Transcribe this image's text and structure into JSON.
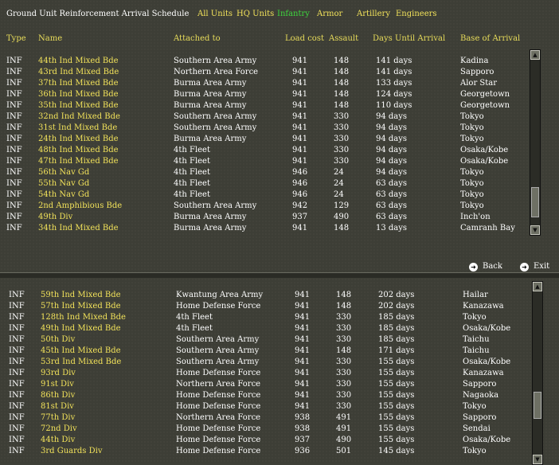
{
  "header": {
    "title": "Ground Unit Reinforcement Arrival Schedule",
    "tabs": [
      {
        "label": "All Units",
        "active": false
      },
      {
        "label": "HQ Units",
        "active": false
      },
      {
        "label": "Infantry",
        "active": true
      },
      {
        "label": "Armor",
        "active": false
      },
      {
        "label": "Artillery",
        "active": false
      },
      {
        "label": "Engineers",
        "active": false
      }
    ]
  },
  "columns": [
    "Type",
    "Name",
    "Attached to",
    "Load cost",
    "Assault",
    "Days Until Arrival",
    "Base of Arrival"
  ],
  "top_rows": [
    [
      "INF",
      "44th Ind Mixed Bde",
      "Southern Area Army",
      "941",
      "148",
      "141 days",
      "Kadina"
    ],
    [
      "INF",
      "43rd Ind Mixed Bde",
      "Northern Area Force",
      "941",
      "148",
      "141 days",
      "Sapporo"
    ],
    [
      "INF",
      "37th Ind Mixed Bde",
      "Burma Area Army",
      "941",
      "148",
      "133 days",
      "Alor Star"
    ],
    [
      "INF",
      "36th Ind Mixed Bde",
      "Burma Area Army",
      "941",
      "148",
      "124 days",
      "Georgetown"
    ],
    [
      "INF",
      "35th Ind Mixed Bde",
      "Burma Area Army",
      "941",
      "148",
      "110 days",
      "Georgetown"
    ],
    [
      "INF",
      "32nd Ind Mixed Bde",
      "Southern Area Army",
      "941",
      "330",
      "94 days",
      "Tokyo"
    ],
    [
      "INF",
      "31st Ind Mixed Bde",
      "Southern Area Army",
      "941",
      "330",
      "94 days",
      "Tokyo"
    ],
    [
      "INF",
      "24th Ind Mixed Bde",
      "Burma Area Army",
      "941",
      "330",
      "94 days",
      "Tokyo"
    ],
    [
      "INF",
      "48th Ind Mixed Bde",
      "4th Fleet",
      "941",
      "330",
      "94 days",
      "Osaka/Kobe"
    ],
    [
      "INF",
      "47th Ind Mixed Bde",
      "4th Fleet",
      "941",
      "330",
      "94 days",
      "Osaka/Kobe"
    ],
    [
      "INF",
      "56th Nav Gd",
      "4th Fleet",
      "946",
      "24",
      "94 days",
      "Tokyo"
    ],
    [
      "INF",
      "55th Nav Gd",
      "4th Fleet",
      "946",
      "24",
      "63 days",
      "Tokyo"
    ],
    [
      "INF",
      "54th Nav Gd",
      "4th Fleet",
      "946",
      "24",
      "63 days",
      "Tokyo"
    ],
    [
      "INF",
      "2nd Amphibious Bde",
      "Southern Area Army",
      "942",
      "129",
      "63 days",
      "Tokyo"
    ],
    [
      "INF",
      "49th Div",
      "Burma Area Army",
      "937",
      "490",
      "63 days",
      "Inch'on"
    ],
    [
      "INF",
      "34th Ind Mixed Bde",
      "Burma Area Army",
      "941",
      "148",
      "13 days",
      "Camranh Bay"
    ]
  ],
  "bottom_rows": [
    [
      "INF",
      "59th Ind Mixed Bde",
      "Kwantung Area Army",
      "941",
      "148",
      "202 days",
      "Hailar"
    ],
    [
      "INF",
      "57th Ind Mixed Bde",
      "Home Defense Force",
      "941",
      "148",
      "202 days",
      "Kanazawa"
    ],
    [
      "INF",
      "128th Ind Mixed Bde",
      "4th Fleet",
      "941",
      "330",
      "185 days",
      "Tokyo"
    ],
    [
      "INF",
      "49th Ind Mixed Bde",
      "4th Fleet",
      "941",
      "330",
      "185 days",
      "Osaka/Kobe"
    ],
    [
      "INF",
      "50th Div",
      "Southern Area Army",
      "941",
      "330",
      "185 days",
      "Taichu"
    ],
    [
      "INF",
      "45th Ind Mixed Bde",
      "Southern Area Army",
      "941",
      "148",
      "171 days",
      "Taichu"
    ],
    [
      "INF",
      "53rd Ind Mixed Bde",
      "Southern Area Army",
      "941",
      "330",
      "155 days",
      "Osaka/Kobe"
    ],
    [
      "INF",
      "93rd Div",
      "Home Defense Force",
      "941",
      "330",
      "155 days",
      "Kanazawa"
    ],
    [
      "INF",
      "91st Div",
      "Northern Area Force",
      "941",
      "330",
      "155 days",
      "Sapporo"
    ],
    [
      "INF",
      "86th Div",
      "Home Defense Force",
      "941",
      "330",
      "155 days",
      "Nagaoka"
    ],
    [
      "INF",
      "81st Div",
      "Home Defense Force",
      "941",
      "330",
      "155 days",
      "Tokyo"
    ],
    [
      "INF",
      "77th Div",
      "Northern Area Force",
      "938",
      "491",
      "155 days",
      "Sapporo"
    ],
    [
      "INF",
      "72nd Div",
      "Home Defense Force",
      "938",
      "491",
      "155 days",
      "Sendai"
    ],
    [
      "INF",
      "44th Div",
      "Home Defense Force",
      "937",
      "490",
      "155 days",
      "Osaka/Kobe"
    ],
    [
      "INF",
      "3rd Guards Div",
      "Home Defense Force",
      "936",
      "501",
      "145 days",
      "Tokyo"
    ]
  ],
  "nav": {
    "back_label": "Back",
    "exit_label": "Exit"
  },
  "icons": {
    "scroll_up": "up-arrow-icon",
    "scroll_down": "down-arrow-icon",
    "nav": "arrow-circle-icon"
  },
  "colors": {
    "tab_active": "#3ed43e",
    "tab_inactive": "#f2e25a",
    "name": "#f2e25a",
    "header": "#e8dc5a",
    "text": "#ffffff"
  }
}
